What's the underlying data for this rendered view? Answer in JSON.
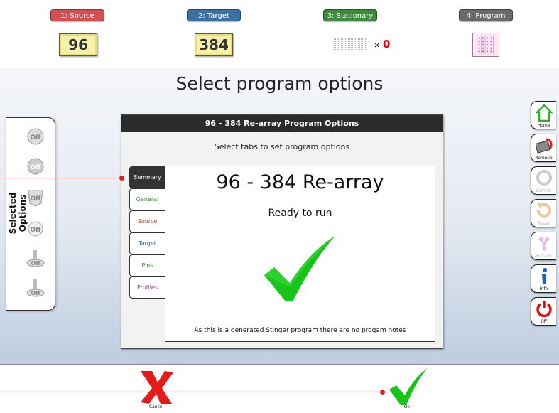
{
  "steps": [
    {
      "label": "1: Source",
      "color": "#d45050"
    },
    {
      "label": "2: Target",
      "color": "#3d6fa5"
    },
    {
      "label": "3: Stationary",
      "color": "#3c8a3c"
    },
    {
      "label": "4: Program",
      "color": "#6a6a6a"
    }
  ],
  "source_plate": "96",
  "target_plate": "384",
  "stationary": {
    "x_label": "×",
    "count": "0"
  },
  "page_title": "Select program options",
  "drawer": {
    "label": "Selected Options"
  },
  "dialog": {
    "title": "96 - 384 Re-array Program Options",
    "subtitle": "Select tabs to set program options",
    "tabs": [
      {
        "label": "Summary",
        "color": "#ffffff"
      },
      {
        "label": "General",
        "color": "#2a9a2a"
      },
      {
        "label": "Source",
        "color": "#c83c3c"
      },
      {
        "label": "Target",
        "color": "#2e5f9c"
      },
      {
        "label": "Pins",
        "color": "#2a8a2a"
      },
      {
        "label": "Profiles",
        "color": "#9a4a8a"
      }
    ],
    "content": {
      "title": "96 - 384 Re-array",
      "status": "Ready to run",
      "note": "As this is a generated Stinger program there are no progam notes"
    }
  },
  "right_buttons": [
    {
      "label": "Home"
    },
    {
      "label": "Remove"
    },
    {
      "label": "Sample"
    },
    {
      "label": "Reset"
    },
    {
      "label": "Hazard"
    },
    {
      "label": "Info"
    },
    {
      "label": "Off"
    }
  ],
  "bottom": {
    "cancel": "Cancel",
    "ok": "Ok"
  },
  "colors": {
    "accent_red": "#d22",
    "check_green": "#19c419"
  }
}
